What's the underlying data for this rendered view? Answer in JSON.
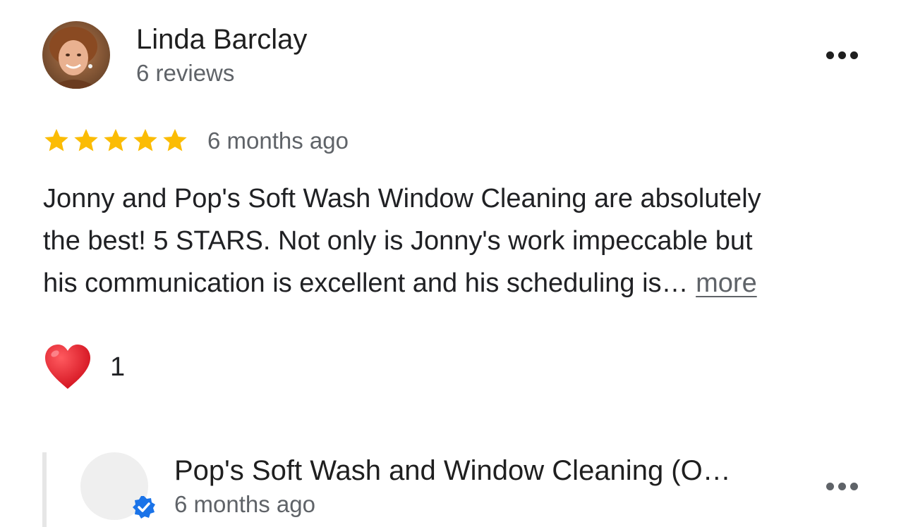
{
  "review": {
    "reviewer": {
      "name": "Linda Barclay",
      "review_count": "6 reviews",
      "avatar_icon": "user-photo"
    },
    "menu_icon": "more-horizontal-icon",
    "rating": 5,
    "rating_max": 5,
    "star_color": "#FBBC04",
    "time": "6 months ago",
    "text_lines": [
      "Jonny and Pop's Soft Wash Window Cleaning are absolutely",
      "the best! 5 STARS. Not only is Jonny's work impeccable but",
      "his communication is excellent and his scheduling is… "
    ],
    "more_label": "more",
    "reaction": {
      "icon": "heart-icon",
      "count": "1",
      "color": "#E0242F"
    }
  },
  "owner_reply": {
    "name": "Pop's Soft Wash and Window Cleaning (O…",
    "time": "6 months ago",
    "verified_icon": "verified-check-icon",
    "verified_color": "#1A73E8",
    "menu_icon": "more-horizontal-icon"
  }
}
